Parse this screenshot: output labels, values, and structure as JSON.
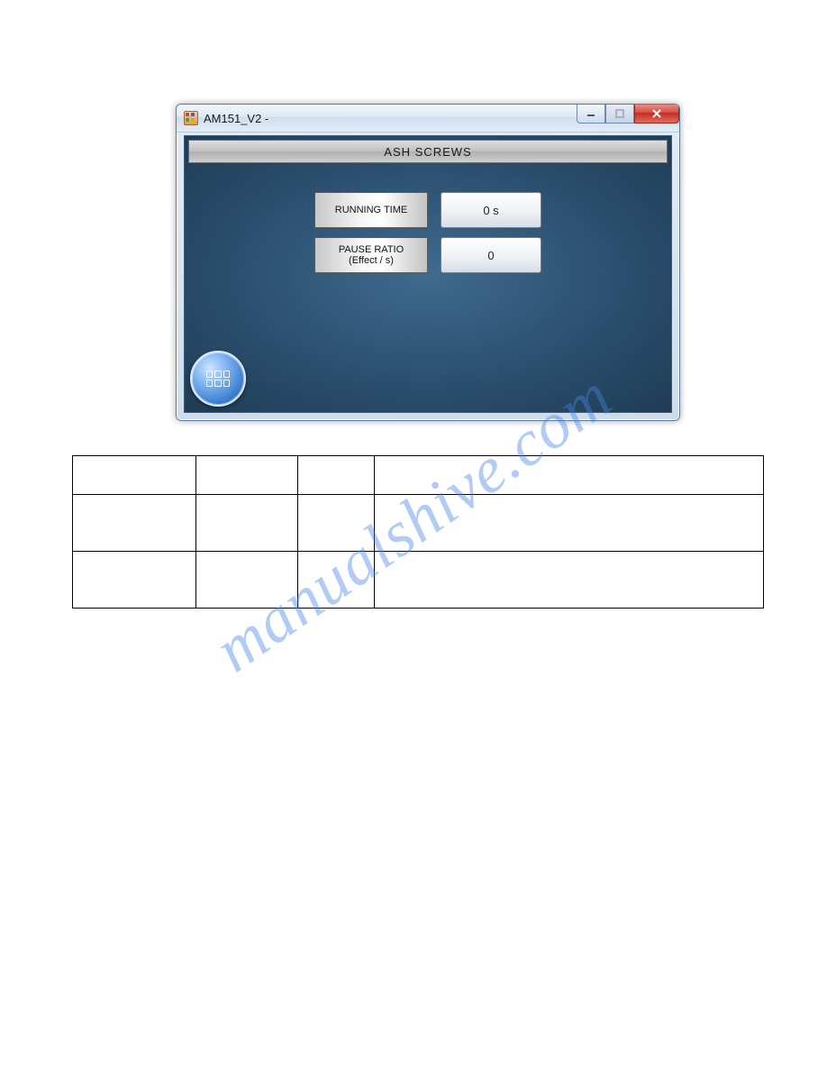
{
  "window": {
    "title": "AM151_V2 -",
    "header": "ASH  SCREWS",
    "rows": [
      {
        "label_line1": "RUNNING TIME",
        "label_line2": "",
        "value": "0 s"
      },
      {
        "label_line1": "PAUSE RATIO",
        "label_line2": "(Effect / s)",
        "value": "0"
      }
    ]
  },
  "watermark": "manualshive.com"
}
